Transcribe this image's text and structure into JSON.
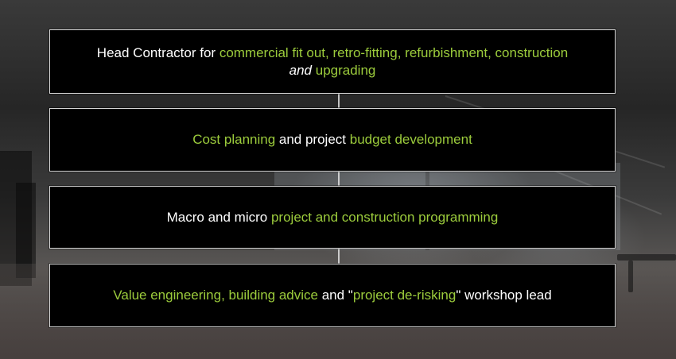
{
  "cards": [
    {
      "id": "head-contractor",
      "parts": [
        {
          "text": "Head Contractor for ",
          "style": "plain"
        },
        {
          "text": "commercial fit out, retro-fitting, refurbishment, construction",
          "style": "highlight"
        },
        {
          "text": "and",
          "style": "italic"
        },
        {
          "text": "upgrading",
          "style": "highlight"
        }
      ]
    },
    {
      "id": "cost-planning",
      "parts": [
        {
          "text": "Cost planning",
          "style": "highlight"
        },
        {
          "text": " and project ",
          "style": "plain"
        },
        {
          "text": "budget development",
          "style": "highlight"
        }
      ]
    },
    {
      "id": "programming",
      "parts": [
        {
          "text": "Macro and micro ",
          "style": "plain"
        },
        {
          "text": "project and construction programming",
          "style": "highlight"
        }
      ]
    },
    {
      "id": "value-engineering",
      "parts": [
        {
          "text": "Value engineering, building advice",
          "style": "highlight"
        },
        {
          "text": " and \"",
          "style": "plain"
        },
        {
          "text": "project de-risking",
          "style": "highlight"
        },
        {
          "text": "\" workshop lead",
          "style": "plain"
        }
      ]
    }
  ],
  "colors": {
    "highlight": "#9ccc3c",
    "text": "#ffffff",
    "card_background": "#000000",
    "card_border": "#d9d9d9"
  }
}
